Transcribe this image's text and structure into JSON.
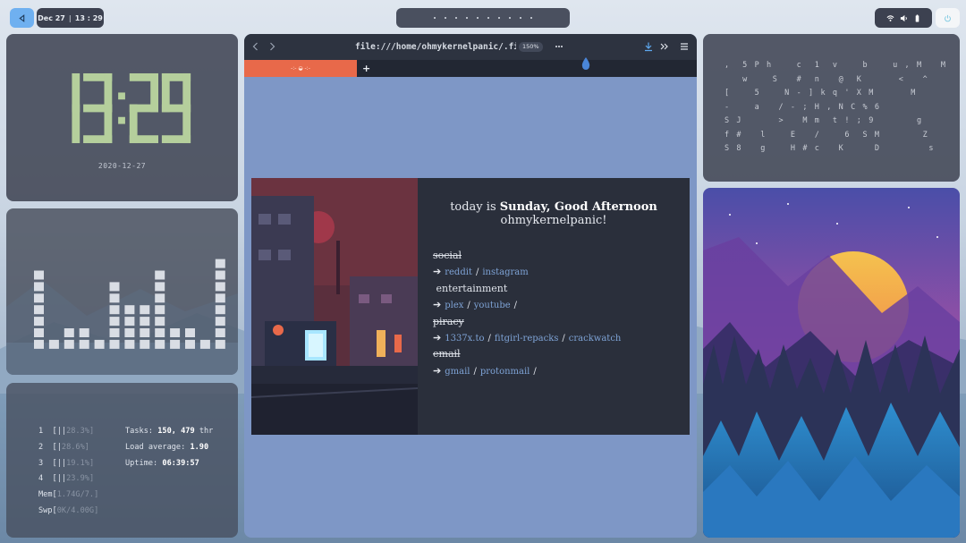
{
  "topbar": {
    "launcher_icon": "launcher-icon",
    "date": "Dec 27",
    "time": "13 : 29",
    "tray_icons": [
      "wifi-icon",
      "volume-icon",
      "battery-icon"
    ],
    "power_icon": "power-icon",
    "accent": "#6fb0f0"
  },
  "clock": {
    "time": "13:29",
    "date": "2020-12-27",
    "color": "#b5cf9c"
  },
  "equalizer": {
    "levels": [
      7,
      1,
      2,
      2,
      1,
      6,
      4,
      4,
      7,
      2,
      2,
      1,
      8
    ]
  },
  "htop": {
    "cpus": [
      {
        "num": "1",
        "bar": "[||",
        "pct": "28.3%]"
      },
      {
        "num": "2",
        "bar": "[|",
        "pct": "28.6%]"
      },
      {
        "num": "3",
        "bar": "[||",
        "pct": "19.1%]"
      },
      {
        "num": "4",
        "bar": "[||",
        "pct": "23.9%]"
      }
    ],
    "mem_label": "Mem[",
    "mem_value": "1.74G/7.]",
    "swp_label": "Swp[",
    "swp_value": "0K/4.00G]",
    "tasks_label": "Tasks:",
    "tasks_value": "150, 479",
    "tasks_suffix": "thr",
    "load_label": "Load average:",
    "load_value": "1.90",
    "uptime_label": "Uptime:",
    "uptime_value": "06:39:57"
  },
  "browser": {
    "url": "file:///home/ohmykernelpanic/.firefox",
    "zoom": "150%",
    "tab_title": "-:- ◒ -:-",
    "new_tab": "+",
    "accent_tab": "#e8694a"
  },
  "startpage": {
    "greeting_prefix": "today is",
    "greeting_day": "Sunday, Good Afternoon",
    "greeting_user": "ohmykernelpanic!",
    "arrow": "➔",
    "sep": "/",
    "categories": [
      {
        "name": "social",
        "links": [
          "reddit",
          "instagram"
        ]
      },
      {
        "name": "entertainment",
        "links": [
          "plex",
          "youtube"
        ]
      },
      {
        "name": "piracy",
        "links": [
          "1337x.to",
          "fitgirl-repacks",
          "crackwatch"
        ]
      },
      {
        "name": "email",
        "links": [
          "gmail",
          "protonmail"
        ]
      }
    ]
  },
  "matrix": {
    "rows": [
      ",  5 P h    c  1  v    b    u , M   M",
      "   w    S   #  n   @  K      <   ^",
      "[    5    N - ] k q ' X M      M",
      "-    a   / - ; H , N C % 6",
      "S J      >   M m  t ! ; 9       g",
      "f #   l    E   /    6  S M       Z",
      "S 8   g    H # c   K     D        s"
    ]
  }
}
